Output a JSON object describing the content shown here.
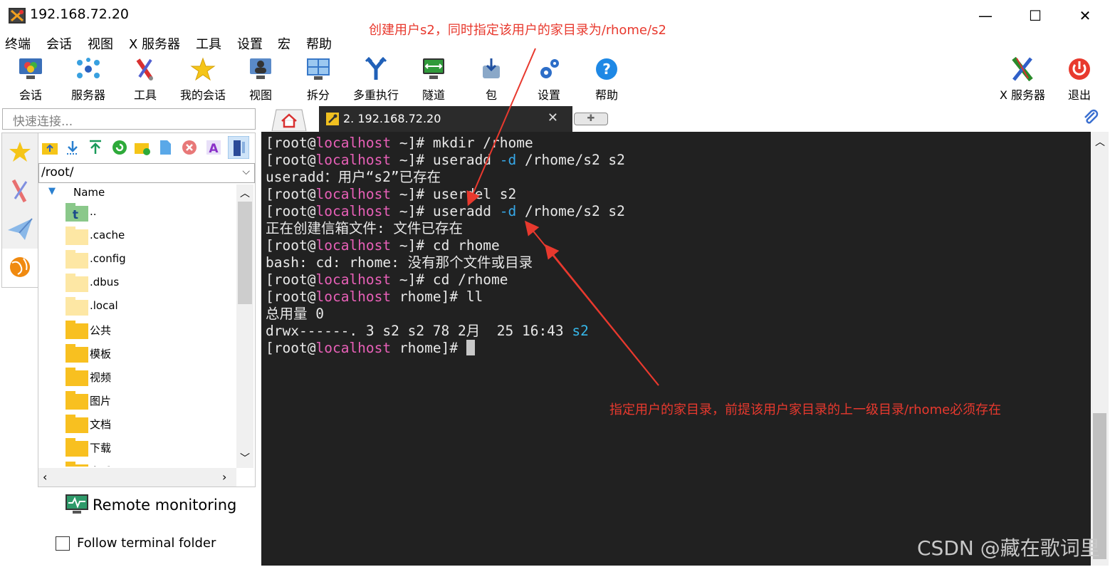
{
  "window": {
    "title": "192.168.72.20"
  },
  "menu": [
    "终端",
    "会话",
    "视图",
    "X 服务器",
    "工具",
    "设置",
    "宏",
    "帮助"
  ],
  "toolbar": {
    "items": [
      "会话",
      "服务器",
      "工具",
      "我的会话",
      "视图",
      "拆分",
      "多重执行",
      "隧道",
      "包",
      "设置",
      "帮助"
    ],
    "x_server": "X 服务器",
    "exit": "退出"
  },
  "quick_connect": {
    "placeholder": "快速连接..."
  },
  "tabs": {
    "active_label": "2. 192.168.72.20"
  },
  "sftp": {
    "path": "/root/",
    "column_name": "Name",
    "files": [
      "..",
      ".cache",
      ".config",
      ".dbus",
      ".local",
      "公共",
      "模板",
      "视频",
      "图片",
      "文档",
      "下载",
      "音乐"
    ]
  },
  "remote_monitoring": "Remote monitoring",
  "follow_terminal": "Follow terminal folder",
  "terminal": {
    "user": "root",
    "host": "localhost",
    "lines": [
      {
        "dir": "~",
        "cmd": " mkdir /rhome"
      },
      {
        "dir": "~",
        "cmd_pre": " useradd ",
        "opt": "-d",
        "cmd_post": " /rhome/s2 s2"
      },
      {
        "out": "useradd：用户“s2”已存在"
      },
      {
        "dir": "~",
        "cmd": " userdel s2"
      },
      {
        "dir": "~",
        "cmd_pre": " useradd ",
        "opt": "-d",
        "cmd_post": " /rhome/s2 s2"
      },
      {
        "out": "正在创建信箱文件: 文件已存在"
      },
      {
        "dir": "~",
        "cmd": " cd rhome"
      },
      {
        "out": "bash: cd: rhome: 没有那个文件或目录"
      },
      {
        "dir": "~",
        "cmd": " cd /rhome"
      },
      {
        "dir": "rhome",
        "cmd": " ll"
      },
      {
        "out": "总用量 0"
      },
      {
        "out_pre": "drwx------. 3 s2 s2 78 2月  25 16:43 ",
        "dirname": "s2"
      },
      {
        "dir": "rhome",
        "cmd": " ",
        "cursor": true
      }
    ]
  },
  "annotations": {
    "top": "创建用户s2，同时指定该用户的家目录为/rhome/s2",
    "bottom": "指定用户的家目录，前提该用户家目录的上一级目录/rhome必须存在"
  },
  "watermark": "CSDN @藏在歌词里",
  "colors": {
    "terminal_bg": "#212121",
    "host": "#e860b8",
    "option": "#36a8e8",
    "annotation": "#e8392e"
  }
}
